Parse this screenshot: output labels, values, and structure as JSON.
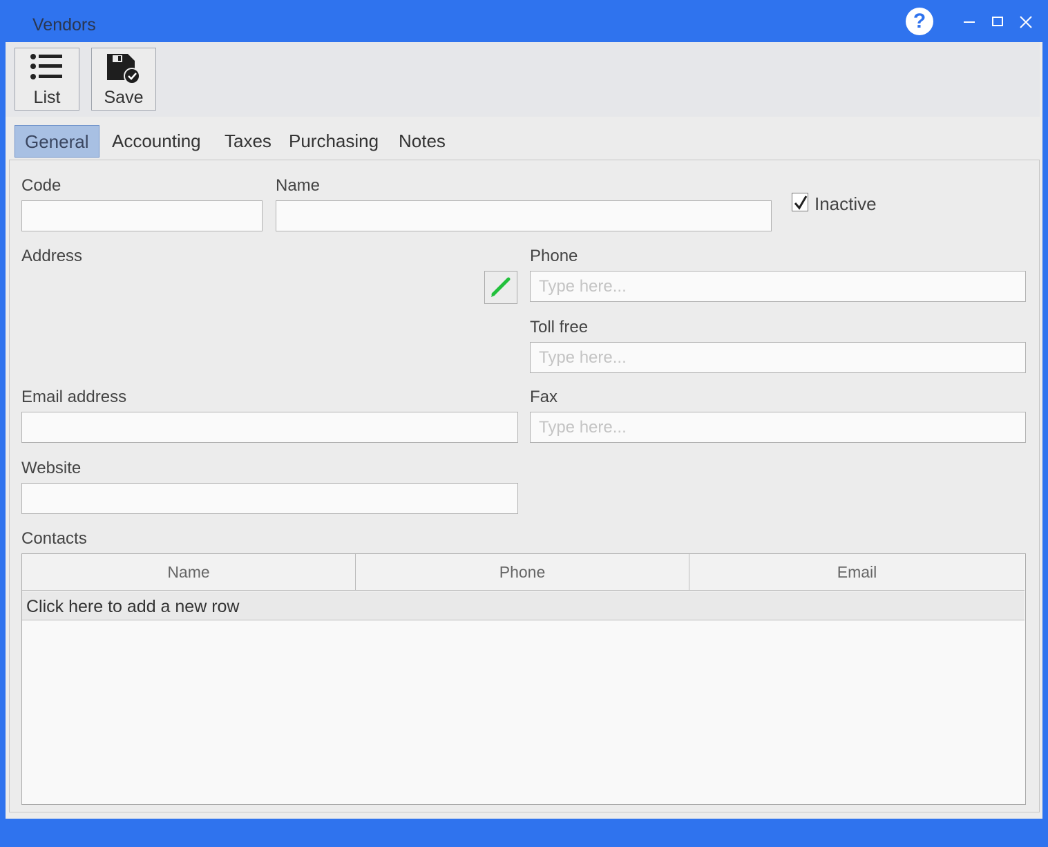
{
  "window": {
    "title": "Vendors",
    "help_label": "?"
  },
  "toolbar": {
    "list_label": "List",
    "save_label": "Save"
  },
  "tabs": [
    {
      "label": "General",
      "active": true
    },
    {
      "label": "Accounting"
    },
    {
      "label": "Taxes"
    },
    {
      "label": "Purchasing"
    },
    {
      "label": "Notes"
    }
  ],
  "form": {
    "code_label": "Code",
    "code_value": "",
    "name_label": "Name",
    "name_value": "",
    "inactive_label": "Inactive",
    "inactive_checked": true,
    "address_label": "Address",
    "phone_label": "Phone",
    "phone_placeholder": "Type here...",
    "tollfree_label": "Toll free",
    "tollfree_placeholder": "Type here...",
    "email_label": "Email address",
    "email_value": "",
    "fax_label": "Fax",
    "fax_placeholder": "Type here...",
    "website_label": "Website",
    "website_value": ""
  },
  "contacts": {
    "label": "Contacts",
    "columns": [
      "Name",
      "Phone",
      "Email"
    ],
    "new_row_text": "Click here to add a new row"
  },
  "icons": {
    "list": "list-icon",
    "save": "save-icon",
    "edit": "pencil-icon",
    "help": "help-icon",
    "minimize": "minimize-icon",
    "maximize": "maximize-icon",
    "close": "close-icon"
  },
  "colors": {
    "titlebar": "#2f73ee",
    "active_tab": "#a8c0e3",
    "pencil": "#22c03c"
  }
}
